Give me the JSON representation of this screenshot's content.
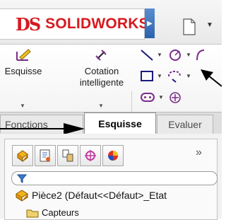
{
  "app": {
    "logo_mark": "DS",
    "logo_name": "SOLIDWORKS",
    "colors": {
      "brand_red": "#d6191f",
      "accent_blue": "#2b62ac"
    }
  },
  "ribbon": {
    "sketch_button_label": "Esquisse",
    "dimension_button_label_line1": "Cotation",
    "dimension_button_label_line2": "intelligente",
    "tools": [
      "line-icon",
      "circle-icon",
      "rectangle-icon",
      "trim-icon",
      "slot-icon",
      "point-icon"
    ]
  },
  "tabs": [
    {
      "label": "Fonctions",
      "active": false
    },
    {
      "label": "Esquisse",
      "active": true
    },
    {
      "label": "Evaluer",
      "active": false
    }
  ],
  "panel": {
    "more_label": "»",
    "tree": {
      "root_label": "Pièce2  (Défaut<<Défaut>_Etat",
      "child_label": "Capteurs"
    }
  }
}
